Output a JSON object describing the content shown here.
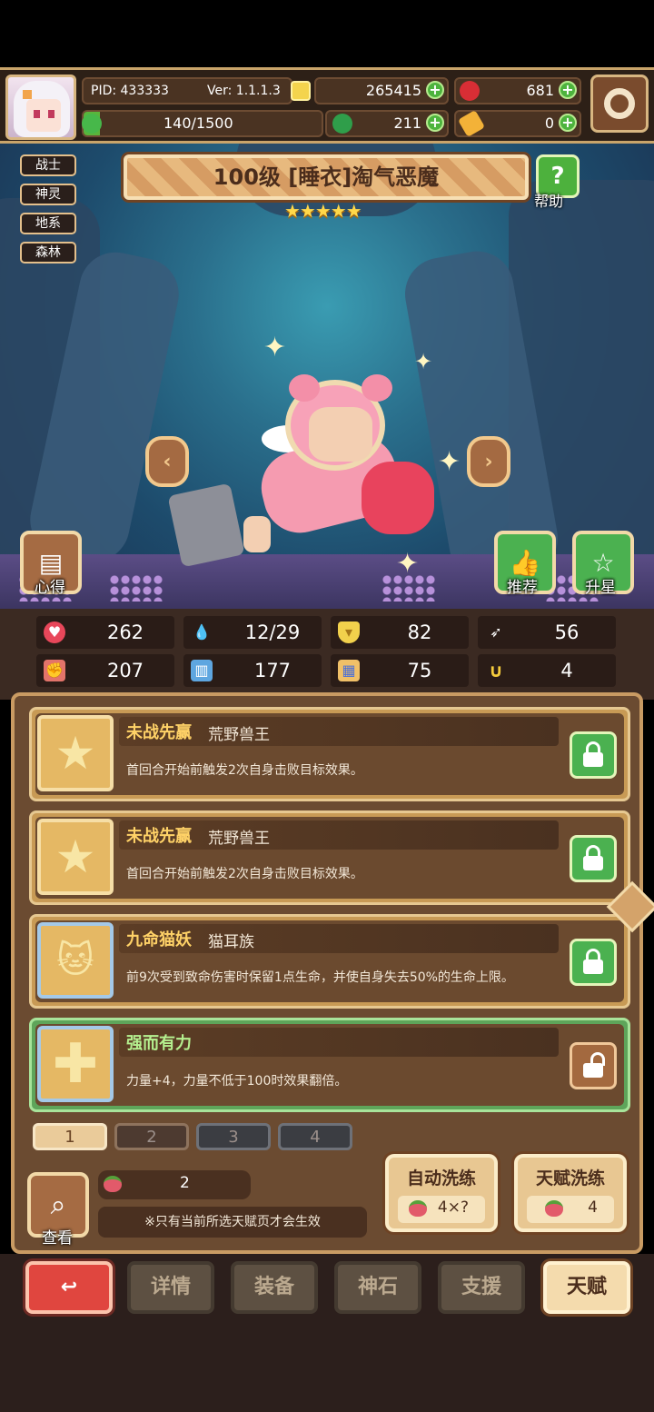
{
  "header": {
    "pid": "PID: 433333",
    "version": "Ver: 1.1.1.3",
    "stamina": "140/1500",
    "gold": "265415",
    "ruby": "681",
    "clover": "211",
    "key": "0"
  },
  "hero": {
    "title": "100级 [睡衣]淘气恶魔",
    "stars": "★★★★★",
    "star_count": 5,
    "tags": [
      "战士",
      "神灵",
      "地系",
      "森林"
    ],
    "help_label": "帮助",
    "notes_label": "心得",
    "recommend_label": "推荐",
    "star_up_label": "升星"
  },
  "stats": [
    {
      "icon": "heart-icon",
      "value": "262"
    },
    {
      "icon": "mana-drop-icon",
      "value": "12/29"
    },
    {
      "icon": "shield-icon",
      "value": "82"
    },
    {
      "icon": "wing-icon",
      "value": "56"
    },
    {
      "icon": "fist-icon",
      "value": "207"
    },
    {
      "icon": "book-icon",
      "value": "177"
    },
    {
      "icon": "scroll-icon",
      "value": "75"
    },
    {
      "icon": "horseshoe-icon",
      "value": "4"
    }
  ],
  "talents": [
    {
      "name": "未战先赢",
      "source": "荒野兽王",
      "desc": "首回合开始前触发2次自身击败目标效果。",
      "icon": "star-icon",
      "locked": true
    },
    {
      "name": "未战先赢",
      "source": "荒野兽王",
      "desc": "首回合开始前触发2次自身击败目标效果。",
      "icon": "star-icon",
      "locked": true
    },
    {
      "name": "九命猫妖",
      "source": "猫耳族",
      "desc": "前9次受到致命伤害时保留1点生命，并使自身失去50%的生命上限。",
      "icon": "cat-icon",
      "locked": true
    },
    {
      "name": "强而有力",
      "source": "",
      "desc": "力量+4，力量不低于100时效果翻倍。",
      "icon": "plus-icon",
      "locked": false
    }
  ],
  "pages": [
    "1",
    "2",
    "3",
    "4"
  ],
  "controls": {
    "look_label": "查看",
    "peach_count": "2",
    "note": "※只有当前所选天赋页才会生效",
    "auto_wash_label": "自动洗练",
    "auto_wash_cost": "4×?",
    "talent_wash_label": "天赋洗练",
    "talent_wash_cost": "4"
  },
  "nav": {
    "details": "详情",
    "equipment": "装备",
    "stone": "神石",
    "support": "支援",
    "talent": "天赋"
  },
  "colors": {
    "accent_gold": "#c99b63",
    "talent_name": "#ffd267",
    "lock_green": "#4bb150",
    "back_red": "#e0463f"
  }
}
